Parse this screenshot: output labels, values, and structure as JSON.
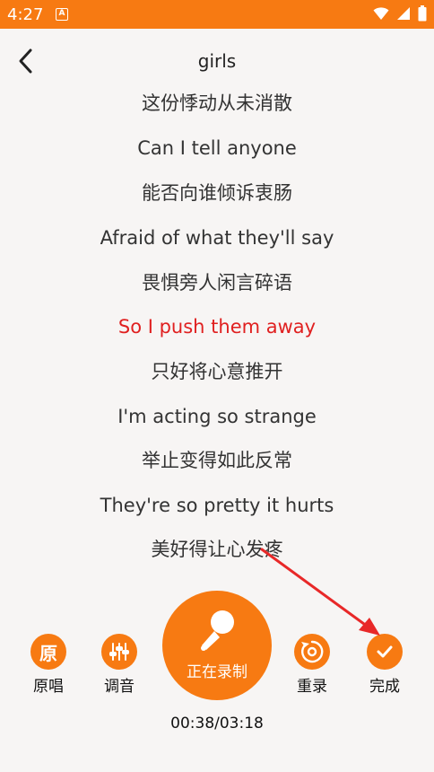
{
  "status_bar": {
    "time": "4:27",
    "accent": "#f77a12",
    "icons": [
      "notification-a-icon",
      "wifi-icon",
      "signal-icon",
      "battery-icon"
    ]
  },
  "header": {
    "back_icon": "chevron-left-icon",
    "title": "girls"
  },
  "lyrics": {
    "lines": [
      "这份悸动从未消散",
      "Can I tell anyone",
      "能否向谁倾诉衷肠",
      "Afraid of what they'll say",
      "畏惧旁人闲言碎语",
      "So I push them away",
      "只好将心意推开",
      "I'm acting so strange",
      "举止变得如此反常",
      "They're so pretty it hurts",
      "美好得让心发疼"
    ],
    "active_index": 5,
    "active_color": "#e02020"
  },
  "controls": {
    "original": {
      "glyph": "原",
      "label": "原唱"
    },
    "tune": {
      "icon": "equalizer-icon",
      "label": "调音"
    },
    "record": {
      "icon": "microphone-icon",
      "label": "正在录制"
    },
    "rerecord": {
      "icon": "restart-icon",
      "label": "重录"
    },
    "done": {
      "icon": "check-icon",
      "label": "完成"
    }
  },
  "progress": {
    "time_text": "00:38/03:18"
  }
}
